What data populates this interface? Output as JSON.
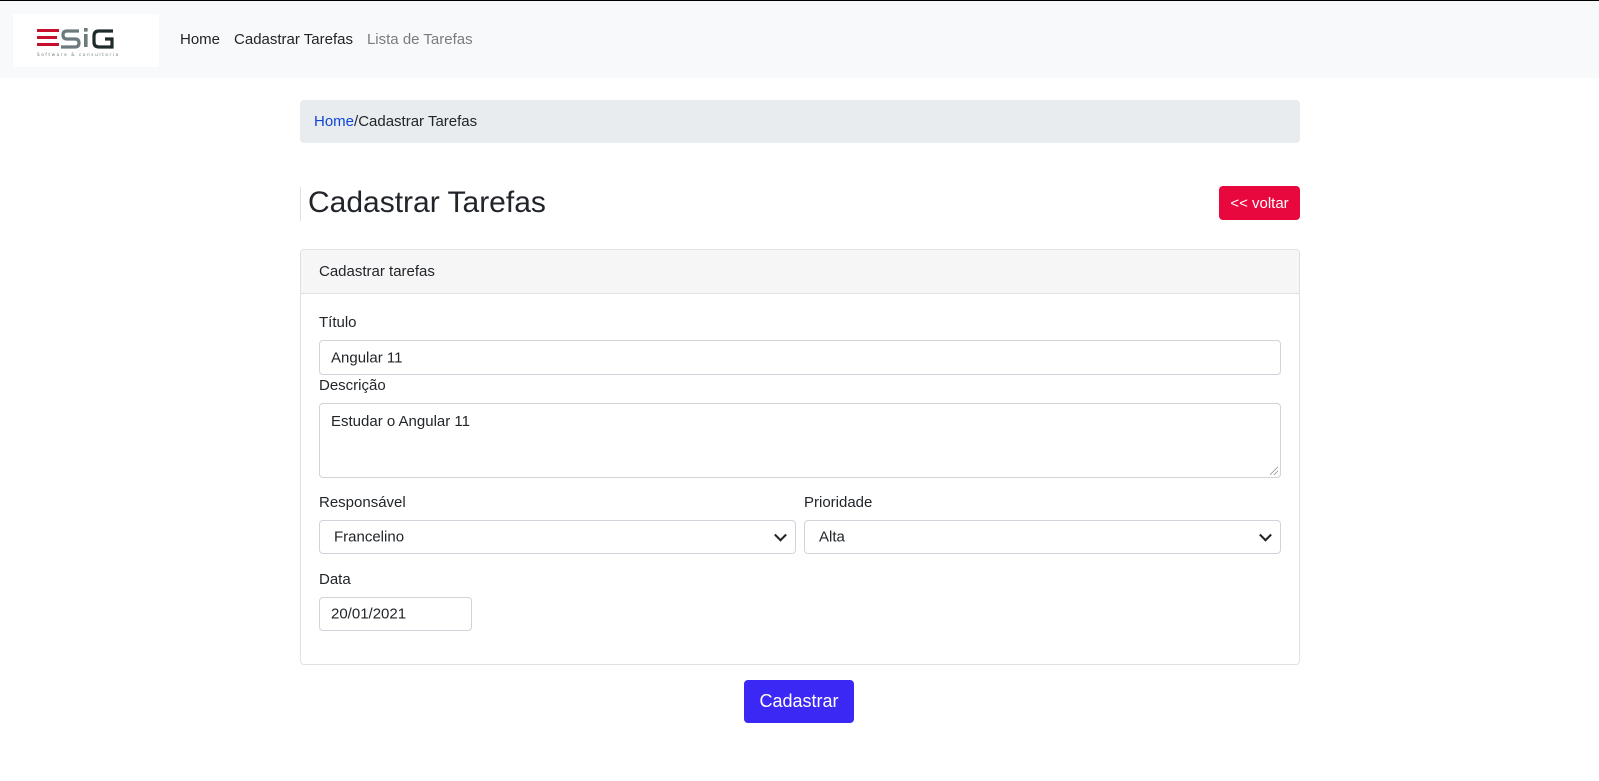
{
  "brand": {
    "logo_text": "ESiG",
    "logo_tagline": "Software & consultoria",
    "colors": {
      "red": "#c8102e",
      "gray": "#6c7a7d",
      "dark": "#1f2a2c"
    }
  },
  "nav": {
    "items": [
      {
        "label": "Home"
      },
      {
        "label": "Cadastrar Tarefas"
      },
      {
        "label": "Lista de Tarefas"
      }
    ]
  },
  "breadcrumb": {
    "home": "Home",
    "separator": "/",
    "current": "Cadastrar Tarefas"
  },
  "page": {
    "title": "Cadastrar Tarefas",
    "back_button": "<< voltar"
  },
  "form": {
    "card_title": "Cadastrar tarefas",
    "titulo": {
      "label": "Título",
      "value": "Angular 11"
    },
    "descricao": {
      "label": "Descrição",
      "value": "Estudar o Angular 11"
    },
    "responsavel": {
      "label": "Responsável",
      "value": "Francelino"
    },
    "prioridade": {
      "label": "Prioridade",
      "value": "Alta"
    },
    "data": {
      "label": "Data",
      "value": "20/01/2021"
    },
    "submit": "Cadastrar"
  },
  "colors": {
    "back_button": "#e8083e",
    "submit_button": "#3c28f5",
    "link": "#0d45d6"
  }
}
